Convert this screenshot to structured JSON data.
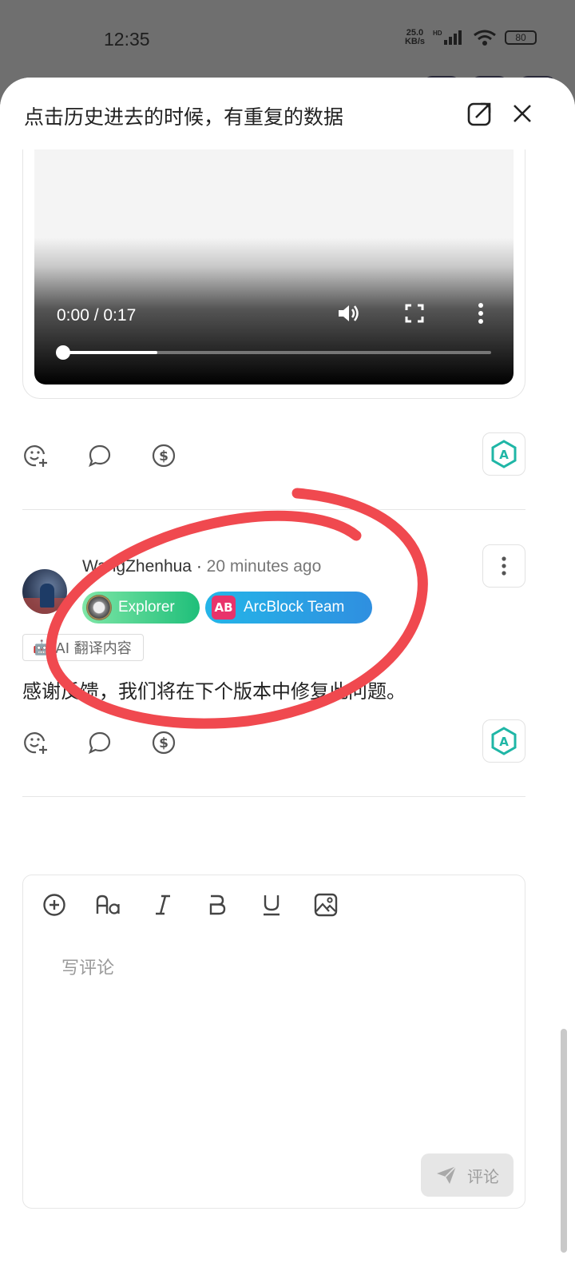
{
  "status_bar": {
    "time": "12:35",
    "net_speed_top": "25.0",
    "net_speed_bottom": "KB/s",
    "net_tag": "HD",
    "battery": "80"
  },
  "sheet": {
    "title": "点击历史进去的时候，有重复的数据"
  },
  "video": {
    "time_display": "0:00 / 0:17",
    "progress": 0.22
  },
  "comment": {
    "author": "WangZhenhua",
    "separator": " · ",
    "time_ago": "20 minutes ago",
    "badges": [
      {
        "label": "Explorer",
        "color": "#1fbf7a"
      },
      {
        "label": "ArcBlock Team",
        "logo_text": "AB",
        "color": "#2f8fe0"
      }
    ],
    "ai_tag": "AI 翻译内容",
    "body": "感谢反馈，我们将在下个版本中修复此问题。"
  },
  "editor": {
    "placeholder": "写评论",
    "send_label": "评论"
  },
  "colors": {
    "annotation": "#f0494f",
    "ai_badge": "#1fb6a6"
  },
  "icons": [
    "open-external-icon",
    "close-icon",
    "volume-icon",
    "fullscreen-icon",
    "more-vertical-icon",
    "emoji-add-icon",
    "comment-icon",
    "dollar-icon",
    "ai-hexagon-icon",
    "plus-circle-icon",
    "font-size-icon",
    "italic-icon",
    "bold-icon",
    "underline-icon",
    "image-icon",
    "send-icon"
  ]
}
